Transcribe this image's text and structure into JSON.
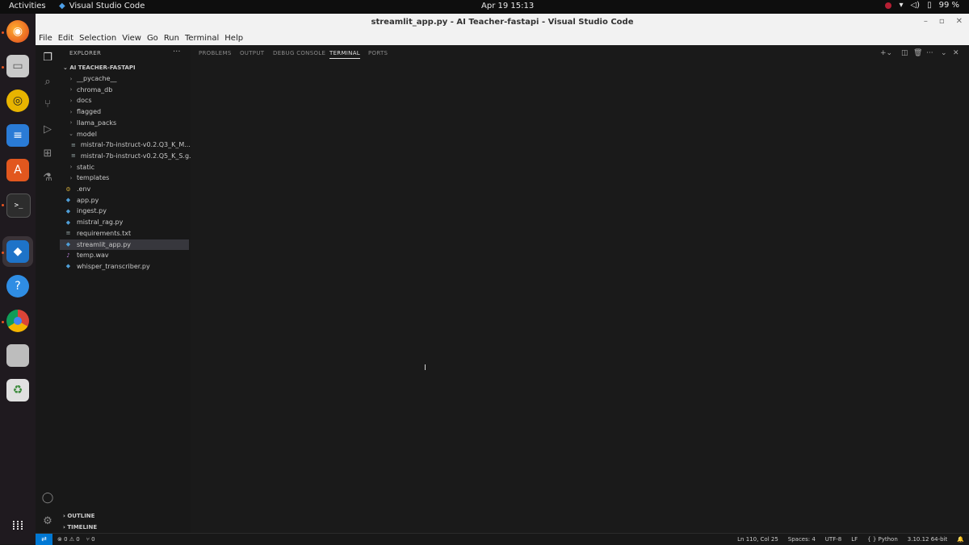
{
  "os": {
    "activities": "Activities",
    "app_name": "Visual Studio Code",
    "clock": "Apr 19  15:13",
    "battery": "99 %"
  },
  "window": {
    "title": "streamlit_app.py - AI Teacher-fastapi - Visual Studio Code"
  },
  "menu": [
    "File",
    "Edit",
    "Selection",
    "View",
    "Go",
    "Run",
    "Terminal",
    "Help"
  ],
  "sidebar": {
    "header": "EXPLORER",
    "more": "···",
    "root": "AI TEACHER-FASTAPI",
    "tree": [
      {
        "label": "__pycache__",
        "kind": "folder",
        "depth": 1
      },
      {
        "label": "chroma_db",
        "kind": "folder",
        "depth": 1
      },
      {
        "label": "docs",
        "kind": "folder",
        "depth": 1
      },
      {
        "label": "flagged",
        "kind": "folder",
        "depth": 1
      },
      {
        "label": "llama_packs",
        "kind": "folder",
        "depth": 1
      },
      {
        "label": "model",
        "kind": "folder-open",
        "depth": 1
      },
      {
        "label": "mistral-7b-instruct-v0.2.Q3_K_M...",
        "kind": "file",
        "depth": 2
      },
      {
        "label": "mistral-7b-instruct-v0.2.Q5_K_S.g...",
        "kind": "file",
        "depth": 2
      },
      {
        "label": "static",
        "kind": "folder",
        "depth": 1
      },
      {
        "label": "templates",
        "kind": "folder",
        "depth": 1
      },
      {
        "label": ".env",
        "kind": "gear",
        "depth": 0
      },
      {
        "label": "app.py",
        "kind": "py",
        "depth": 0
      },
      {
        "label": "ingest.py",
        "kind": "py",
        "depth": 0
      },
      {
        "label": "mistral_rag.py",
        "kind": "py",
        "depth": 0
      },
      {
        "label": "requirements.txt",
        "kind": "txt",
        "depth": 0
      },
      {
        "label": "streamlit_app.py",
        "kind": "py",
        "depth": 0,
        "selected": true
      },
      {
        "label": "temp.wav",
        "kind": "audio",
        "depth": 0
      },
      {
        "label": "whisper_transcriber.py",
        "kind": "py",
        "depth": 0
      }
    ],
    "outline": "OUTLINE",
    "timeline": "TIMELINE"
  },
  "panel": {
    "tabs": [
      "PROBLEMS",
      "OUTPUT",
      "DEBUG CONSOLE",
      "TERMINAL",
      "PORTS"
    ],
    "active_tab": "TERMINAL"
  },
  "statusbar": {
    "remote": "⇄",
    "errors": "⊗ 0 ⚠ 0",
    "ports": "⑂ 0",
    "position": "Ln 110, Col 25",
    "spaces": "Spaces: 4",
    "encoding": "UTF-8",
    "eol": "LF",
    "language": "{ } Python",
    "interpreter": "3.10.12 64-bit",
    "notifications": "🔔"
  }
}
